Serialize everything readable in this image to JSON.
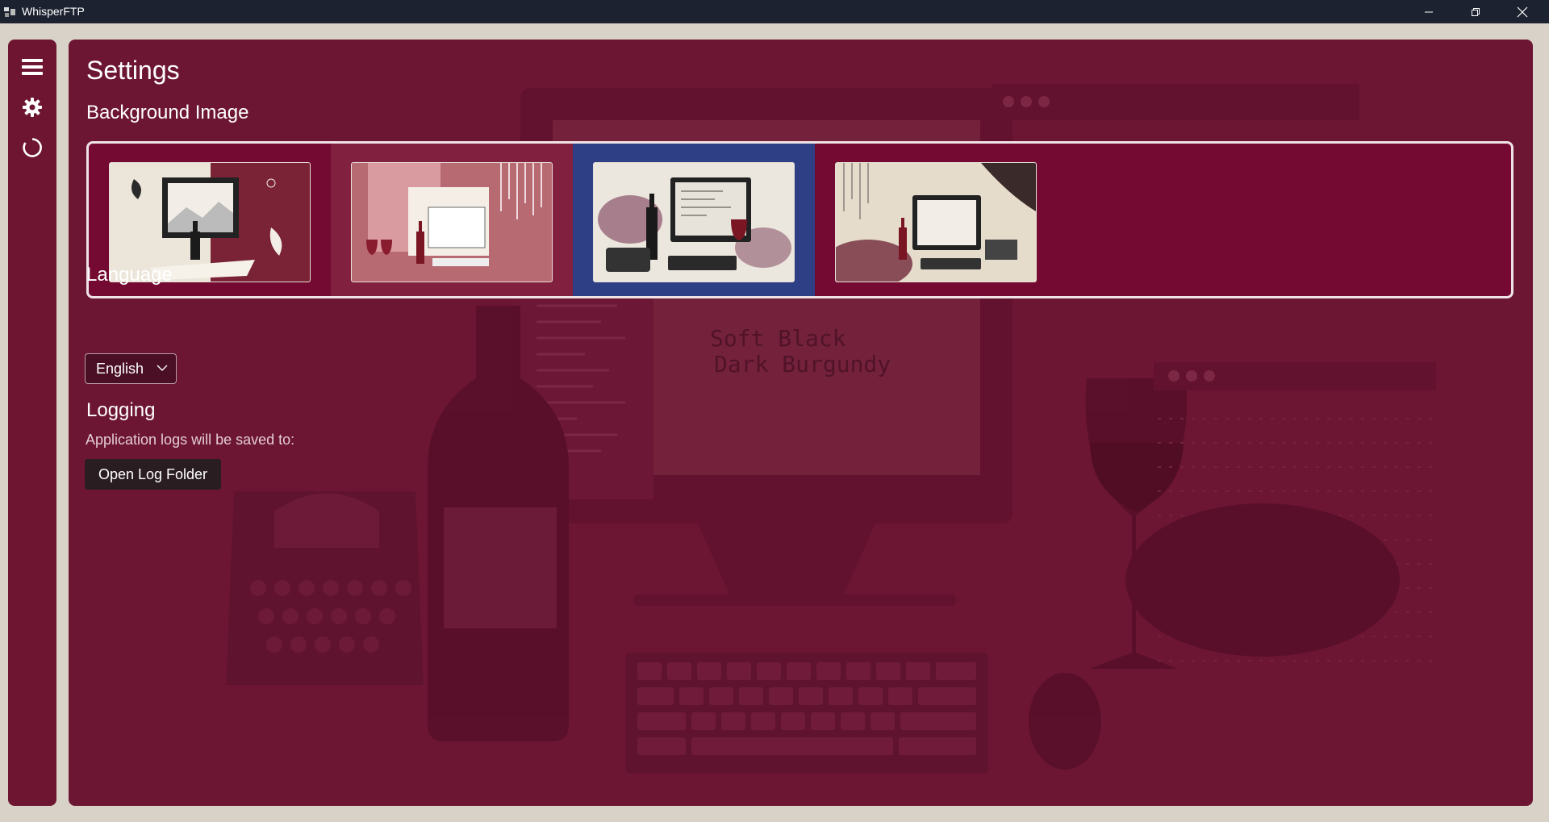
{
  "window": {
    "title": "WhisperFTP"
  },
  "sidebar": {
    "items": [
      {
        "icon": "menu-icon"
      },
      {
        "icon": "gear-icon"
      },
      {
        "icon": "refresh-icon"
      }
    ]
  },
  "settings": {
    "title": "Settings",
    "background_image": {
      "heading": "Background Image",
      "options_count": 4,
      "selected_index": 2
    },
    "language": {
      "heading": "Language",
      "selected": "English"
    },
    "logging": {
      "heading": "Logging",
      "description": "Application logs will be saved to:",
      "open_button": "Open Log Folder"
    }
  },
  "background_art": {
    "palette_heading": "Soft Black",
    "palette_subheading": "Dark Burgundy"
  },
  "colors": {
    "titlebar": "#1d2230",
    "panel": "#6d1634",
    "gallery": "#740a32",
    "selected_tile": "#2f3f86",
    "accent_border": "#efe3e6"
  }
}
